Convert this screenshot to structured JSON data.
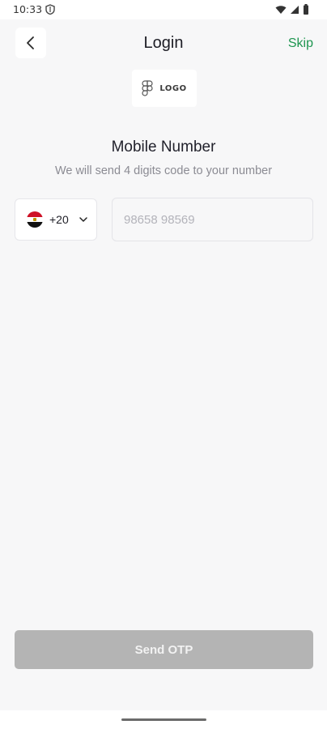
{
  "status_bar": {
    "time": "10:33",
    "icons": [
      "shield-icon",
      "wifi-icon",
      "signal-icon",
      "battery-icon"
    ]
  },
  "header": {
    "title": "Login",
    "skip_label": "Skip",
    "back_icon": "chevron-left-icon"
  },
  "logo": {
    "text": "LOGO",
    "icon": "figma-logo-icon"
  },
  "section": {
    "title": "Mobile Number",
    "subtitle": "We will send 4 digits code to your number"
  },
  "phone_form": {
    "country_flag": "egypt-flag-icon",
    "dial_code": "+20",
    "phone_value": "",
    "phone_placeholder": "98658 98569"
  },
  "actions": {
    "send_otp_label": "Send OTP"
  },
  "colors": {
    "accent_green": "#1e9650",
    "disabled_button": "#b4b4b4",
    "background": "#f7f7f8"
  }
}
